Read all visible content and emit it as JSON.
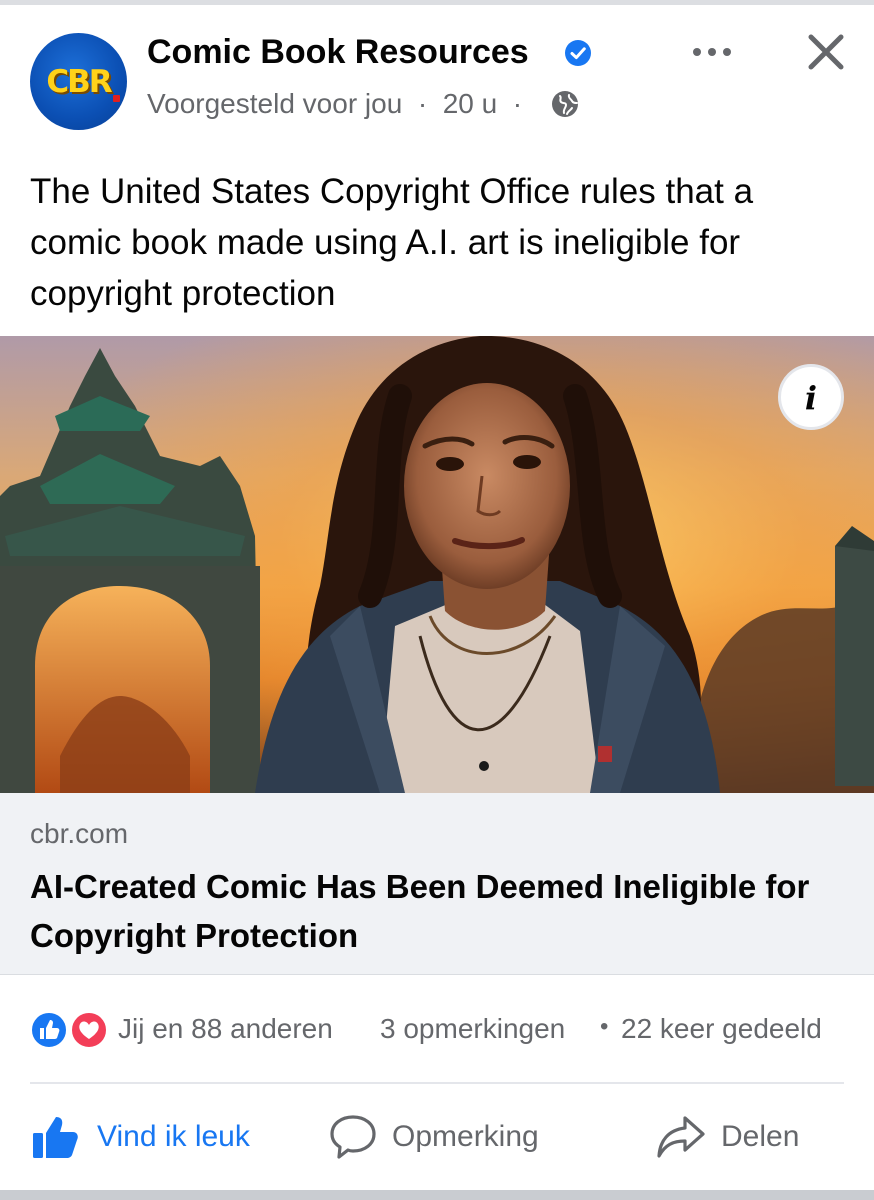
{
  "post": {
    "page_name": "Comic Book Resources",
    "avatar_text": "CBR",
    "meta_suggested": "Voorgesteld voor jou",
    "meta_time": "20 u",
    "text": "The United States Copyright Office rules that a comic book made using A.I. art is ineligible for copyright protection",
    "info_label": "i"
  },
  "link": {
    "domain": "cbr.com",
    "title": "AI-Created Comic Has Been Deemed Ineligible for Copyright Protection"
  },
  "engagement": {
    "reactions": "Jij en 88 anderen",
    "comments": "3 opmerkingen",
    "separator": "•",
    "shares": "22 keer gedeeld"
  },
  "actions": {
    "like": "Vind ik leuk",
    "comment": "Opmerking",
    "share": "Delen"
  },
  "colors": {
    "accent": "#1877f2",
    "secondary_text": "#65676b",
    "love": "#f33e58"
  },
  "icons": [
    "verified-badge-icon",
    "globe-icon",
    "more-icon",
    "close-icon",
    "info-icon",
    "like-reaction-icon",
    "love-reaction-icon",
    "thumbs-up-icon",
    "comment-icon",
    "share-icon"
  ]
}
